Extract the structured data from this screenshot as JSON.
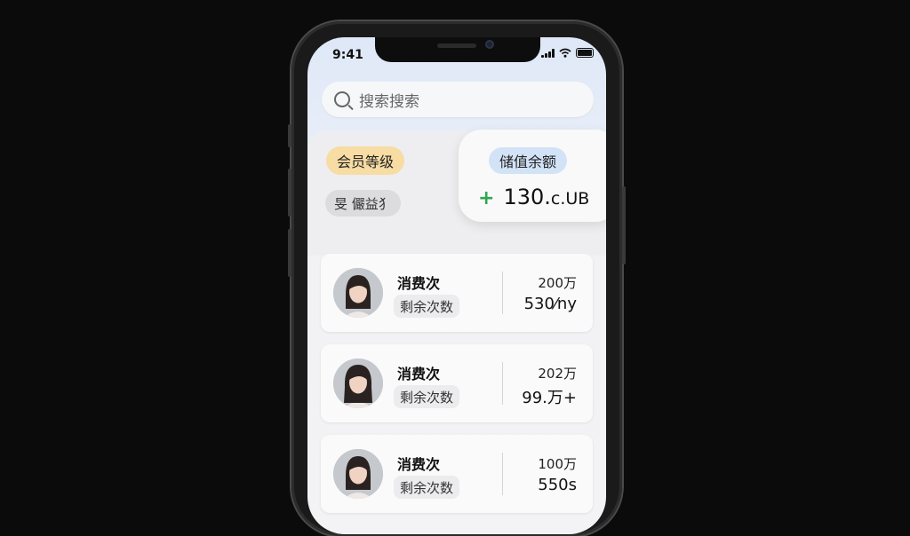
{
  "status_bar": {
    "time": "9:41"
  },
  "search": {
    "placeholder": "搜索搜索"
  },
  "member": {
    "level_label": "会员等级",
    "name": "旻 儼益犭"
  },
  "balance": {
    "label": "储值余额",
    "amount": "130.",
    "unit": "c.UB"
  },
  "records": [
    {
      "title": "消费次",
      "tag": "剩余次数",
      "top_value": "200万",
      "bottom_value": "530⁄ny"
    },
    {
      "title": "消费次",
      "tag": "剩余次数",
      "top_value": "202万",
      "bottom_value": "99.万+"
    },
    {
      "title": "消费次",
      "tag": "剩余次数",
      "top_value": "100万",
      "bottom_value": "550s"
    }
  ],
  "colors": {
    "accent_green": "#2ea84f",
    "member_badge": "#f7dca3",
    "balance_badge": "#d3e3f7"
  }
}
